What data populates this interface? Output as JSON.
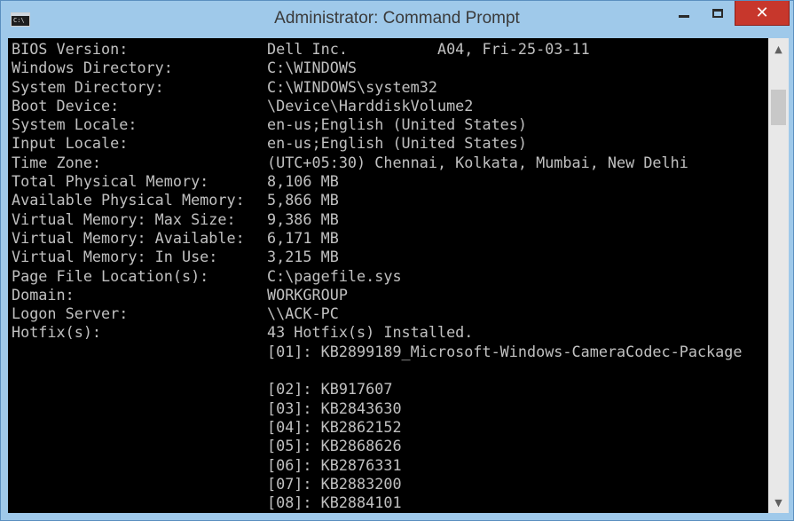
{
  "window": {
    "title": "Administrator: Command Prompt",
    "icon": "cmd-icon",
    "icon_text": "C:\\",
    "controls": {
      "minimize": "minimize-icon",
      "maximize": "maximize-icon",
      "close": "close-icon",
      "close_glyph": "✕"
    },
    "colors": {
      "titlebar": "#9fc9ea",
      "close_button": "#c7372c",
      "console_bg": "#000000",
      "console_text": "#c0c0c0"
    }
  },
  "console": {
    "lines": [
      {
        "label": "BIOS Version:",
        "value": "Dell Inc.          A04, Fri-25-03-11"
      },
      {
        "label": "Windows Directory:",
        "value": "C:\\WINDOWS"
      },
      {
        "label": "System Directory:",
        "value": "C:\\WINDOWS\\system32"
      },
      {
        "label": "Boot Device:",
        "value": "\\Device\\HarddiskVolume2"
      },
      {
        "label": "System Locale:",
        "value": "en-us;English (United States)"
      },
      {
        "label": "Input Locale:",
        "value": "en-us;English (United States)"
      },
      {
        "label": "Time Zone:",
        "value": "(UTC+05:30) Chennai, Kolkata, Mumbai, New Delhi"
      },
      {
        "label": "Total Physical Memory:",
        "value": "8,106 MB"
      },
      {
        "label": "Available Physical Memory:",
        "value": "5,866 MB"
      },
      {
        "label": "Virtual Memory: Max Size:",
        "value": "9,386 MB"
      },
      {
        "label": "Virtual Memory: Available:",
        "value": "6,171 MB"
      },
      {
        "label": "Virtual Memory: In Use:",
        "value": "3,215 MB"
      },
      {
        "label": "Page File Location(s):",
        "value": "C:\\pagefile.sys"
      },
      {
        "label": "Domain:",
        "value": "WORKGROUP"
      },
      {
        "label": "Logon Server:",
        "value": "\\\\ACK-PC"
      },
      {
        "label": "Hotfix(s):",
        "value": "43 Hotfix(s) Installed."
      },
      {
        "label": "",
        "value": "[01]: KB2899189_Microsoft-Windows-CameraCodec-Package"
      },
      {
        "label": "",
        "value": ""
      },
      {
        "label": "",
        "value": "[02]: KB917607"
      },
      {
        "label": "",
        "value": "[03]: KB2843630"
      },
      {
        "label": "",
        "value": "[04]: KB2862152"
      },
      {
        "label": "",
        "value": "[05]: KB2868626"
      },
      {
        "label": "",
        "value": "[06]: KB2876331"
      },
      {
        "label": "",
        "value": "[07]: KB2883200"
      },
      {
        "label": "",
        "value": "[08]: KB2884101"
      }
    ]
  },
  "scrollbar": {
    "up_arrow": "chevron-up-icon",
    "down_arrow": "chevron-down-icon",
    "up_glyph": "▲",
    "down_glyph": "▼"
  }
}
